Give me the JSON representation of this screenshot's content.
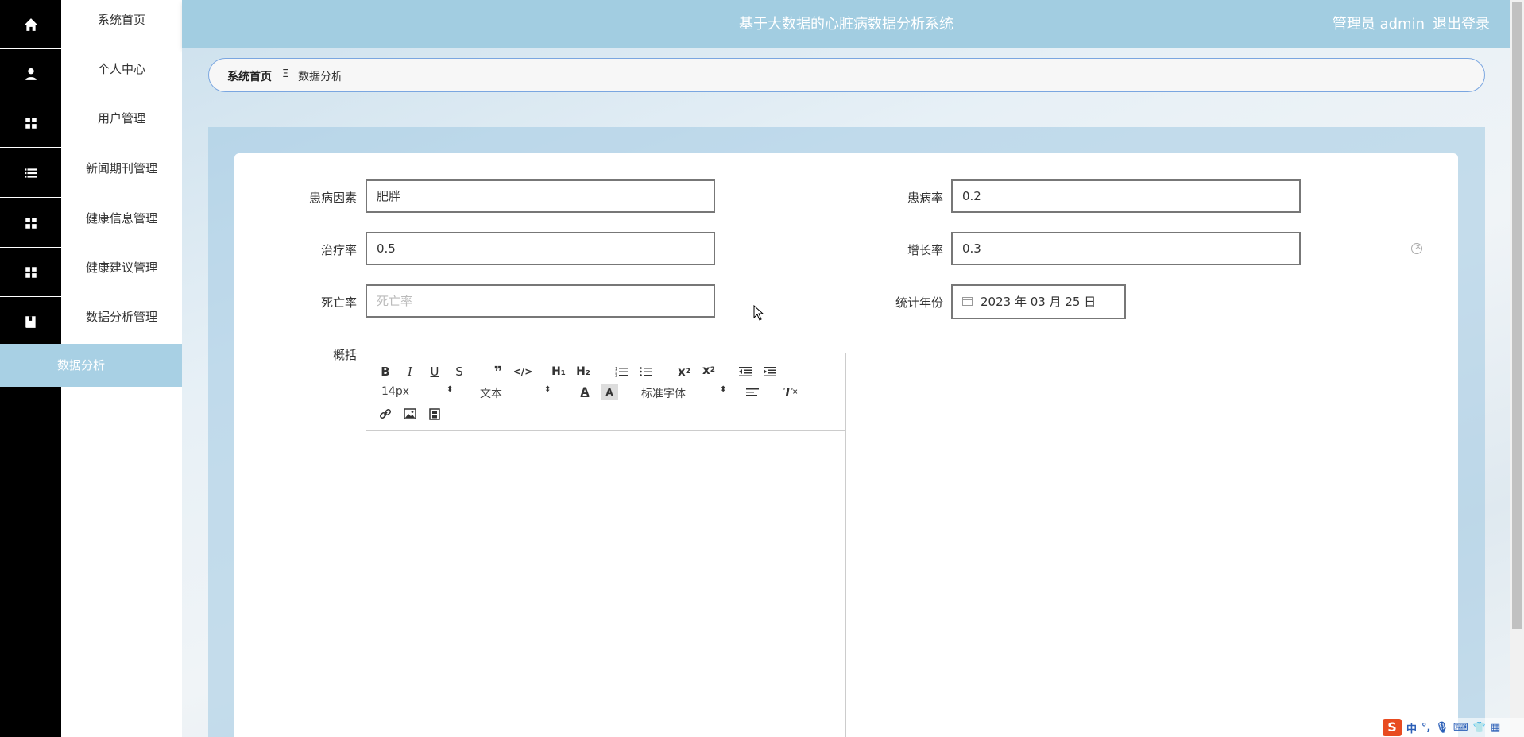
{
  "sidebar": {
    "items": [
      {
        "label": "系统首页",
        "icon": "home-icon"
      },
      {
        "label": "个人中心",
        "icon": "user-icon"
      },
      {
        "label": "用户管理",
        "icon": "grid-icon"
      },
      {
        "label": "新闻期刊管理",
        "icon": "list-icon"
      },
      {
        "label": "健康信息管理",
        "icon": "grid-icon"
      },
      {
        "label": "健康建议管理",
        "icon": "grid-icon"
      },
      {
        "label": "数据分析管理",
        "icon": "book-icon"
      }
    ],
    "active_sub": "数据分析"
  },
  "header": {
    "title": "基于大数据的心脏病数据分析系统",
    "user": "管理员 admin",
    "logout": "退出登录"
  },
  "breadcrumb": {
    "home": "系统首页",
    "separator": "Ξ",
    "current": "数据分析"
  },
  "form": {
    "risk_factor": {
      "label": "患病因素",
      "value": "肥胖"
    },
    "prevalence": {
      "label": "患病率",
      "value": "0.2"
    },
    "treatment_rate": {
      "label": "治疗率",
      "value": "0.5"
    },
    "growth_rate": {
      "label": "增长率",
      "value": "0.3"
    },
    "mortality": {
      "label": "死亡率",
      "placeholder": "死亡率",
      "value": ""
    },
    "stat_year": {
      "label": "统计年份",
      "value": "2023 年 03 月 25 日"
    },
    "summary": {
      "label": "概括"
    }
  },
  "editor": {
    "font_size": "14px",
    "block_format": "文本",
    "font_family": "标准字体"
  },
  "ime": {
    "logo": "S",
    "mode": "中"
  },
  "colors": {
    "header_bg": "#a2cde1",
    "sidebar_strip": "#000000",
    "active_sub_bg": "#a8d0e4",
    "breadcrumb_border": "#7aa6e0"
  }
}
